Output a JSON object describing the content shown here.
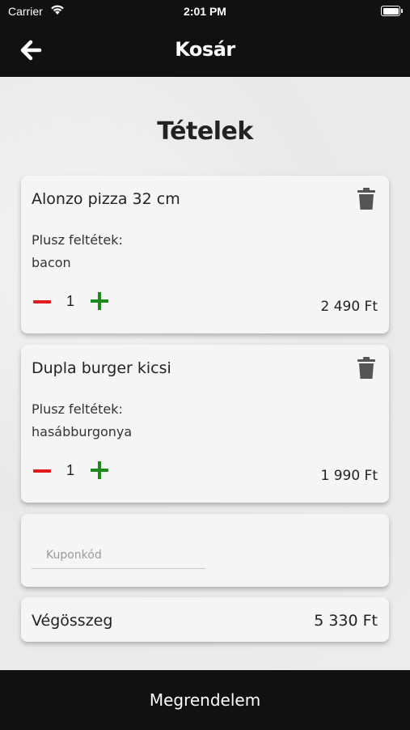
{
  "status_bar": {
    "carrier": "Carrier",
    "time": "2:01 PM"
  },
  "nav": {
    "title": "Kosár",
    "back_icon": "arrow-left-icon"
  },
  "heading": "Tételek",
  "items": [
    {
      "name": "Alonzo pizza 32 cm",
      "extras_label": "Plusz feltétek:",
      "extras": "bacon",
      "quantity": "1",
      "price": "2 490 Ft"
    },
    {
      "name": "Dupla burger kicsi",
      "extras_label": "Plusz feltétek:",
      "extras": "hasábburgonya",
      "quantity": "1",
      "price": "1 990 Ft"
    }
  ],
  "coupon": {
    "placeholder": "Kuponkód",
    "value": ""
  },
  "total": {
    "label": "Végösszeg",
    "value": "5 330 Ft"
  },
  "order_button": "Megrendelem",
  "colors": {
    "minus": "#e21b1b",
    "plus": "#1a8a1a",
    "trash": "#555555",
    "bar_bg": "#111111"
  }
}
